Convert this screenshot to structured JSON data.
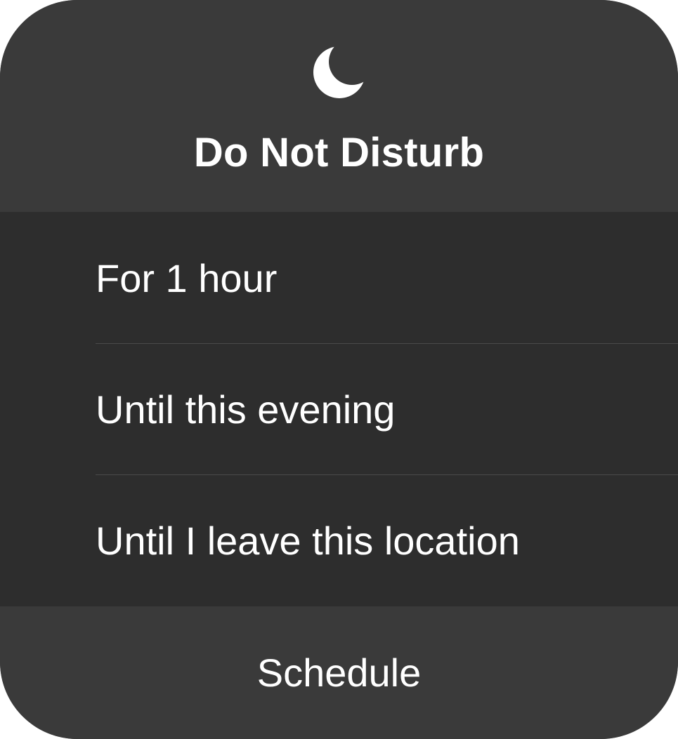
{
  "dialog": {
    "icon": "moon-icon",
    "title": "Do Not Disturb",
    "options": [
      {
        "label": "For 1 hour"
      },
      {
        "label": "Until this evening"
      },
      {
        "label": "Until I leave this location"
      }
    ],
    "footer_label": "Schedule"
  },
  "colors": {
    "panel_background": "#3a3a3a",
    "options_background": "#2d2d2d",
    "text": "#ffffff",
    "divider": "#505050"
  }
}
